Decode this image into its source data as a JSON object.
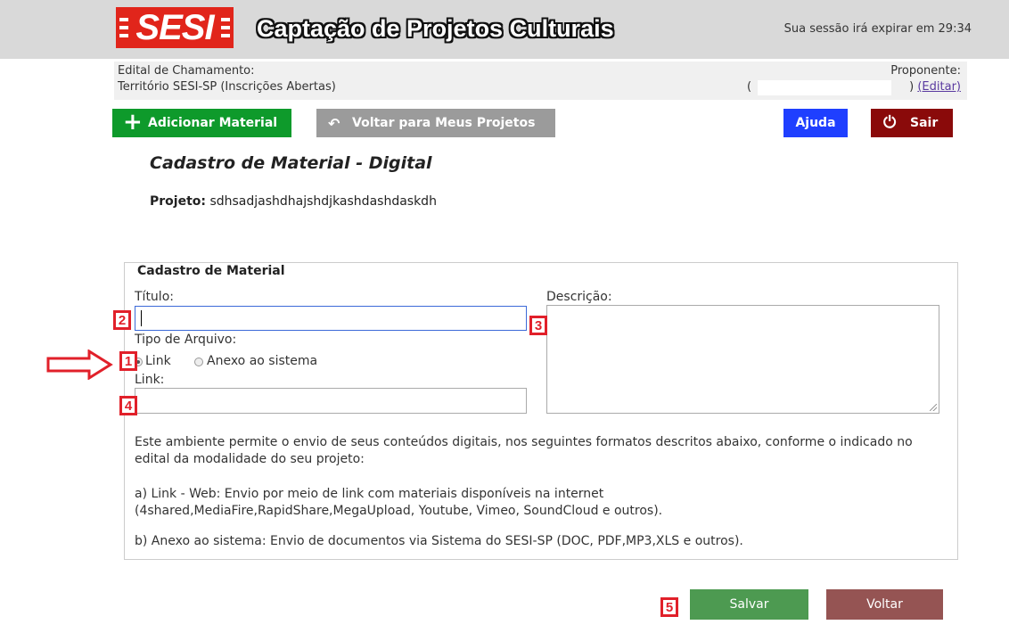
{
  "header": {
    "logo_text": "SESI",
    "app_title": "Captação de Projetos Culturais",
    "session_text": "Sua sessão irá expirar em 29:34"
  },
  "info": {
    "edital_label": "Edital de Chamamento:",
    "edital_value": "Território SESI-SP (Inscrições Abertas)",
    "proponente_label": "Proponente:",
    "paren_open": "(",
    "paren_close": ")",
    "edit_link": "(Editar)"
  },
  "toolbar": {
    "add_label": "Adicionar Material",
    "back_label": "Voltar para Meus Projetos",
    "help_label": "Ajuda",
    "exit_label": "Sair"
  },
  "page": {
    "title": "Cadastro de Material - Digital",
    "project_label": "Projeto:",
    "project_value": "sdhsadjashdhajshdjkashdashdaskdh"
  },
  "form": {
    "legend": "Cadastro de Material",
    "titulo_label": "Título:",
    "titulo_value": "",
    "descricao_label": "Descrição:",
    "descricao_value": "",
    "tipo_label": "Tipo de Arquivo:",
    "radio_link_label": "Link",
    "radio_anexo_label": "Anexo ao sistema",
    "selected_type": "Link",
    "link_label": "Link:",
    "link_value": ""
  },
  "help": {
    "intro": "Este ambiente permite o envio de seus conteúdos digitais, nos seguintes formatos descritos abaixo, conforme o indicado no edital da modalidade do seu projeto:",
    "item_a_line1": "a) Link - Web: Envio por meio de link com materiais disponíveis na internet",
    "item_a_line2": "(4shared,MediaFire,RapidShare,MegaUpload, Youtube, Vimeo, SoundCloud e outros).",
    "item_b": "b) Anexo ao sistema: Envio de documentos via Sistema do SESI-SP (DOC, PDF,MP3,XLS e outros)."
  },
  "actions": {
    "save_label": "Salvar",
    "back_label": "Voltar"
  },
  "markers": [
    "1",
    "2",
    "3",
    "4",
    "5"
  ],
  "colors": {
    "brand_red": "#e1251b",
    "add_green": "#0e9a2b",
    "help_blue": "#1f3fff",
    "exit_red": "#8a0a0a",
    "save_green": "#4d9a51",
    "voltar_red": "#955453",
    "marker_red": "#e1202a"
  }
}
